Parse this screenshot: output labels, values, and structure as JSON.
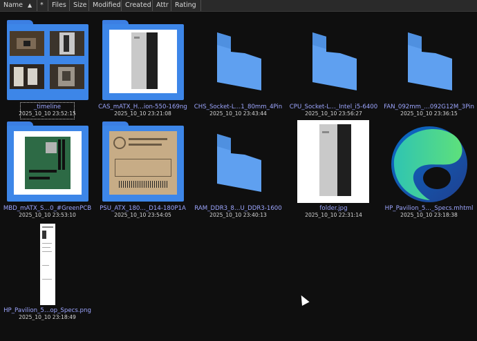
{
  "columns": [
    "Name",
    "*",
    "Files",
    "Size",
    "Modified",
    "Created",
    "Attr",
    "Rating"
  ],
  "items": [
    {
      "name": "_timeline",
      "date": "2025_10_10 23:52:15",
      "kind": "folder-photos",
      "selected": true
    },
    {
      "name": "CAS_mATX_H…ion-550-169ng",
      "date": "2025_10_10 23:21:08",
      "kind": "folder-case"
    },
    {
      "name": "CHS_Socket-L…1_80mm_4Pin",
      "date": "2025_10_10 23:43:44",
      "kind": "empty-folder"
    },
    {
      "name": "CPU_Socket-L…_Intel_i5-6400",
      "date": "2025_10_10 23:56:27",
      "kind": "empty-folder"
    },
    {
      "name": "FAN_092mm_…092G12M_3Pin",
      "date": "2025_10_10 23:36:15",
      "kind": "empty-folder"
    },
    {
      "name": "MBD_mATX_S…0_#GreenPCB",
      "date": "2025_10_10 23:53:10",
      "kind": "folder-motherboard"
    },
    {
      "name": "PSU_ATX_180…_D14-180P1A",
      "date": "2025_10_10 23:54:05",
      "kind": "folder-psu"
    },
    {
      "name": "RAM_DDR3_8…U_DDR3-1600",
      "date": "2025_10_10 23:40:13",
      "kind": "empty-folder"
    },
    {
      "name": "folder.jpg",
      "date": "2025_10_10 22:31:14",
      "kind": "image-case"
    },
    {
      "name": "HP_Pavilion_5…_Specs.mhtml",
      "date": "2025_10_10 23:18:38",
      "kind": "edge-file"
    },
    {
      "name": "HP_Pavilion_5…op_Specs.png",
      "date": "2025_10_10 23:18:49",
      "kind": "image-doc"
    }
  ],
  "colors": {
    "folder": "#3d86e8",
    "empty_folder": "#5fa0f0",
    "name_text": "#9da6ff"
  }
}
